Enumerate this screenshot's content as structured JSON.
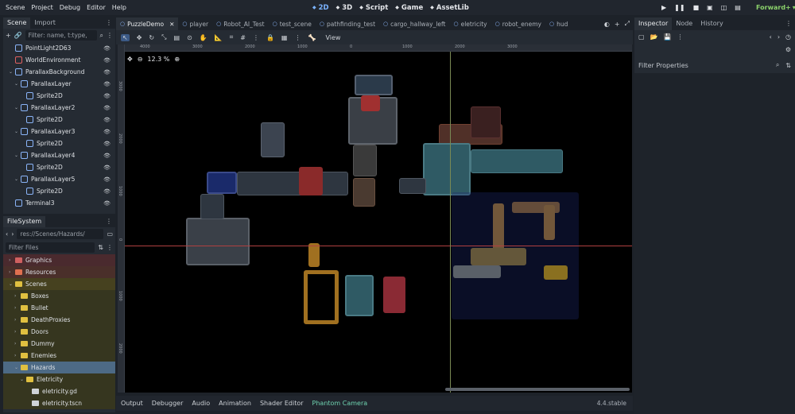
{
  "menu": [
    "Scene",
    "Project",
    "Debug",
    "Editor",
    "Help"
  ],
  "modes": [
    {
      "label": "2D",
      "icon": "2d-icon",
      "active": true
    },
    {
      "label": "3D",
      "icon": "3d-icon",
      "active": false
    },
    {
      "label": "Script",
      "icon": "script-icon",
      "active": false
    },
    {
      "label": "Game",
      "icon": "game-icon",
      "active": false
    },
    {
      "label": "AssetLib",
      "icon": "assetlib-icon",
      "active": false
    }
  ],
  "renderer": "Forward+",
  "scene_dock": {
    "tabs": [
      "Scene",
      "Import"
    ],
    "filter_placeholder": "Filter: name, t:type,",
    "nodes": [
      {
        "label": "PointLight2D63",
        "indent": 1,
        "color": "#8ab4f8"
      },
      {
        "label": "WorldEnvironment",
        "indent": 1,
        "color": "#e06060"
      },
      {
        "label": "ParallaxBackground",
        "indent": 1,
        "color": "#8ab4f8"
      },
      {
        "label": "ParallaxLayer",
        "indent": 2,
        "color": "#8ab4f8"
      },
      {
        "label": "Sprite2D",
        "indent": 3,
        "color": "#8ab4f8"
      },
      {
        "label": "ParallaxLayer2",
        "indent": 2,
        "color": "#8ab4f8"
      },
      {
        "label": "Sprite2D",
        "indent": 3,
        "color": "#8ab4f8"
      },
      {
        "label": "ParallaxLayer3",
        "indent": 2,
        "color": "#8ab4f8"
      },
      {
        "label": "Sprite2D",
        "indent": 3,
        "color": "#8ab4f8"
      },
      {
        "label": "ParallaxLayer4",
        "indent": 2,
        "color": "#8ab4f8"
      },
      {
        "label": "Sprite2D",
        "indent": 3,
        "color": "#8ab4f8"
      },
      {
        "label": "ParallaxLayer5",
        "indent": 2,
        "color": "#8ab4f8"
      },
      {
        "label": "Sprite2D",
        "indent": 3,
        "color": "#8ab4f8"
      },
      {
        "label": "Terminal3",
        "indent": 1,
        "color": "#8ab4f8"
      }
    ]
  },
  "filesystem": {
    "tab": "FileSystem",
    "path": "res://Scenes/Hazards/",
    "filter_placeholder": "Filter Files",
    "items": [
      {
        "label": "Graphics",
        "indent": 1,
        "color": "#d06060",
        "bg": "#4a2a2e"
      },
      {
        "label": "Resources",
        "indent": 1,
        "color": "#e07050",
        "bg": "#4a2f2a"
      },
      {
        "label": "Scenes",
        "indent": 1,
        "color": "#e0c040",
        "bg": "#46411f"
      },
      {
        "label": "Boxes",
        "indent": 2,
        "color": "#e0c040",
        "bg": "#36361f"
      },
      {
        "label": "Bullet",
        "indent": 2,
        "color": "#e0c040",
        "bg": "#36361f"
      },
      {
        "label": "DeathProxies",
        "indent": 2,
        "color": "#e0c040",
        "bg": "#36361f"
      },
      {
        "label": "Doors",
        "indent": 2,
        "color": "#e0c040",
        "bg": "#36361f"
      },
      {
        "label": "Dummy",
        "indent": 2,
        "color": "#e0c040",
        "bg": "#36361f"
      },
      {
        "label": "Enemies",
        "indent": 2,
        "color": "#e0c040",
        "bg": "#36361f"
      },
      {
        "label": "Hazards",
        "indent": 2,
        "color": "#e0c040",
        "bg": "#4d6a85"
      },
      {
        "label": "Eletricity",
        "indent": 3,
        "color": "#e0c040",
        "bg": "#36361f"
      },
      {
        "label": "eletricity.gd",
        "indent": 4,
        "color": "#cfd3d8",
        "bg": "#36361f"
      },
      {
        "label": "eletricity.tscn",
        "indent": 4,
        "color": "#cfd3d8",
        "bg": "#36361f"
      }
    ]
  },
  "scene_tabs": [
    {
      "label": "PuzzleDemo",
      "active": true
    },
    {
      "label": "player",
      "active": false
    },
    {
      "label": "Robot_AI_Test",
      "active": false
    },
    {
      "label": "test_scene",
      "active": false
    },
    {
      "label": "pathfinding_test",
      "active": false
    },
    {
      "label": "cargo_hallway_left",
      "active": false
    },
    {
      "label": "eletricity",
      "active": false
    },
    {
      "label": "robot_enemy",
      "active": false
    },
    {
      "label": "hud",
      "active": false
    }
  ],
  "toolbar_view": "View",
  "zoom_level": "12.3 %",
  "ruler_labels_h": [
    "4000",
    "3000",
    "2000",
    "1000",
    "0",
    "1000",
    "2000",
    "3000"
  ],
  "ruler_labels_v": [
    "3000",
    "2000",
    "1000",
    "0",
    "1000",
    "2000"
  ],
  "bottom_tabs": [
    "Output",
    "Debugger",
    "Audio",
    "Animation",
    "Shader Editor",
    "Phantom Camera"
  ],
  "version": "4.4.stable",
  "inspector": {
    "tabs": [
      "Inspector",
      "Node",
      "History"
    ],
    "filter_placeholder": "Filter Properties"
  },
  "colors": {
    "accent": "#7ab3ff",
    "renderer": "#8bd26b",
    "axis_x": "#b04040",
    "axis_y": "#7a8a55"
  }
}
